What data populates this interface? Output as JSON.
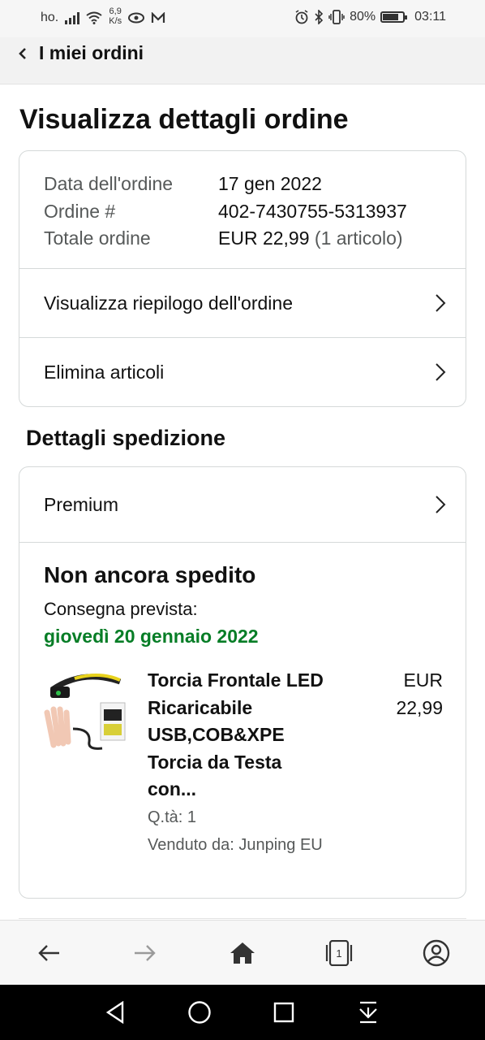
{
  "status_bar": {
    "carrier": "ho.",
    "speed_value": "6,9",
    "speed_unit": "K/s",
    "battery_percent": "80%",
    "battery_level": 0.8,
    "time": "03:11"
  },
  "header": {
    "back_label": "I miei ordini"
  },
  "page_title": "Visualizza dettagli ordine",
  "order_info": {
    "date_label": "Data dell'ordine",
    "date_value": "17 gen 2022",
    "number_label": "Ordine #",
    "number_value": "402-7430755-5313937",
    "total_label": "Totale ordine",
    "total_value": "EUR 22,99",
    "total_items": "(1 articolo)"
  },
  "links": {
    "summary": "Visualizza riepilogo dell'ordine",
    "delete_items": "Elimina articoli"
  },
  "shipping": {
    "section_title": "Dettagli spedizione",
    "method": "Premium",
    "status": "Non ancora spedito",
    "delivery_label": "Consegna prevista:",
    "delivery_date": "giovedì 20 gennaio 2022",
    "date_color": "#067d26"
  },
  "product": {
    "title_lines": [
      "Torcia Frontale LED",
      "Ricaricabile",
      "USB,COB&XPE",
      "Torcia da Testa",
      "con..."
    ],
    "price_currency": "EUR",
    "price_value": "22,99",
    "quantity": "Q.tà: 1",
    "seller": "Venduto da: Junping EU"
  },
  "toolbar": {
    "back_icon": "arrow-left-icon",
    "forward_icon": "arrow-right-icon",
    "home_icon": "home-icon",
    "tabs_count": "1",
    "account_icon": "account-icon"
  }
}
